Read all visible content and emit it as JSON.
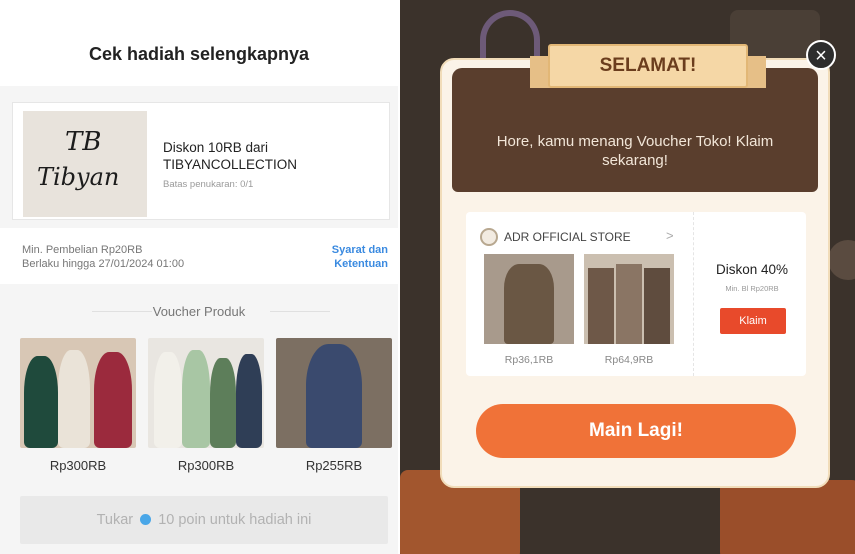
{
  "left_panel": {
    "title": "Cek hadiah selengkapnya",
    "voucher": {
      "logo_line1": "TB",
      "logo_line2": "Tibyan",
      "title": "Diskon 10RB dari TIBYANCOLLECTION",
      "limit": "Batas penukaran: 0/1"
    },
    "min_purchase": "Min. Pembelian Rp20RB",
    "valid_until": "Berlaku hingga 27/01/2024 01:00",
    "terms_line1": "Syarat dan",
    "terms_line2": "Ketentuan",
    "section_title": "Voucher Produk",
    "products": [
      {
        "price": "Rp300RB"
      },
      {
        "price": "Rp300RB"
      },
      {
        "price": "Rp255RB"
      }
    ],
    "exchange_button": {
      "prefix": "Tukar",
      "suffix": "10 poin untuk hadiah ini"
    }
  },
  "right_panel": {
    "close_label": "×",
    "banner": "SELAMAT!",
    "message": "Hore, kamu menang Voucher Toko! Klaim sekarang!",
    "store_name": "ADR OFFICIAL STORE",
    "store_arrow": ">",
    "items": [
      {
        "price": "Rp36,1RB"
      },
      {
        "price": "Rp64,9RB"
      }
    ],
    "discount": "Diskon 40%",
    "min_spend": "Min. Bl Rp20RB",
    "claim_label": "Klaim",
    "play_again": "Main Lagi!"
  },
  "colors": {
    "accent_orange": "#f07238",
    "claim_red": "#e84a2b",
    "link_blue": "#3a8ae0",
    "modal_brown": "#5a3e2d"
  }
}
